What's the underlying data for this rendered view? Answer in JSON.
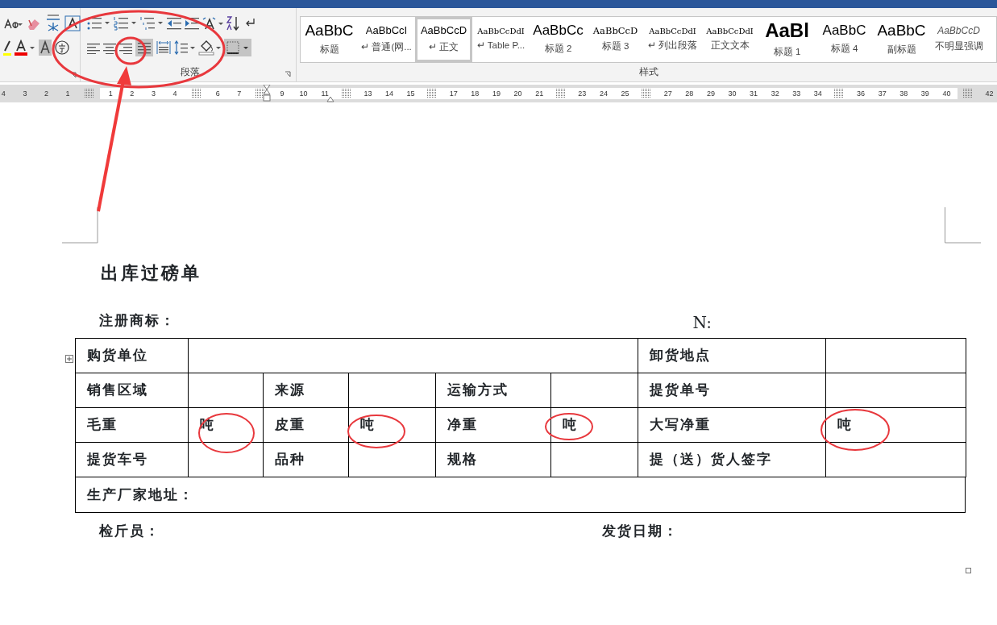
{
  "paragraph_group": {
    "label": "段落"
  },
  "styles_group": {
    "label": "样式",
    "items": [
      {
        "preview": "AaBbC",
        "label": "标题",
        "kind": "title",
        "selected": false
      },
      {
        "preview": "AaBbCcI",
        "label": "↵ 普通(网...",
        "kind": "normal",
        "selected": false
      },
      {
        "preview": "AaBbCcD",
        "label": "↵ 正文",
        "kind": "normal",
        "selected": true
      },
      {
        "preview": "AaBbCcDdI",
        "label": "↵ Table P...",
        "kind": "small",
        "selected": false
      },
      {
        "preview": "AaBbCc",
        "label": "标题 2",
        "kind": "large",
        "selected": false
      },
      {
        "preview": "AaBbCcD",
        "label": "标题 3",
        "kind": "serif",
        "selected": false
      },
      {
        "preview": "AaBbCcDdI",
        "label": "↵ 列出段落",
        "kind": "small",
        "selected": false
      },
      {
        "preview": "AaBbCcDdI",
        "label": "正文文本",
        "kind": "small",
        "selected": false
      },
      {
        "preview": "AaBl",
        "label": "标题 1",
        "kind": "huge",
        "selected": false
      },
      {
        "preview": "AaBbC",
        "label": "标题 4",
        "kind": "large",
        "selected": false
      },
      {
        "preview": "AaBbC",
        "label": "副标题",
        "kind": "title",
        "selected": false
      },
      {
        "preview": "AaBbCcD",
        "label": "不明显强调",
        "kind": "italic",
        "selected": false
      }
    ]
  },
  "ruler": {
    "left_margin": [
      {
        "kind": "num",
        "text": "4"
      },
      {
        "kind": "num",
        "text": "3"
      },
      {
        "kind": "num",
        "text": "2"
      },
      {
        "kind": "num",
        "text": "1"
      },
      {
        "kind": "cell"
      }
    ],
    "body": [
      {
        "kind": "num",
        "text": "1"
      },
      {
        "kind": "num",
        "text": "2"
      },
      {
        "kind": "num",
        "text": "3"
      },
      {
        "kind": "num",
        "text": "4"
      },
      {
        "kind": "cell"
      },
      {
        "kind": "num",
        "text": "6"
      },
      {
        "kind": "num",
        "text": "7"
      },
      {
        "kind": "cell"
      },
      {
        "kind": "num",
        "text": "9"
      },
      {
        "kind": "num",
        "text": "10"
      },
      {
        "kind": "num",
        "text": "11"
      },
      {
        "kind": "cell"
      },
      {
        "kind": "num",
        "text": "13"
      },
      {
        "kind": "num",
        "text": "14"
      },
      {
        "kind": "num",
        "text": "15"
      },
      {
        "kind": "cell"
      },
      {
        "kind": "num",
        "text": "17"
      },
      {
        "kind": "num",
        "text": "18"
      },
      {
        "kind": "num",
        "text": "19"
      },
      {
        "kind": "num",
        "text": "20"
      },
      {
        "kind": "num",
        "text": "21"
      },
      {
        "kind": "cell"
      },
      {
        "kind": "num",
        "text": "23"
      },
      {
        "kind": "num",
        "text": "24"
      },
      {
        "kind": "num",
        "text": "25"
      },
      {
        "kind": "cell"
      },
      {
        "kind": "num",
        "text": "27"
      },
      {
        "kind": "num",
        "text": "28"
      },
      {
        "kind": "num",
        "text": "29"
      },
      {
        "kind": "num",
        "text": "30"
      },
      {
        "kind": "num",
        "text": "31"
      },
      {
        "kind": "num",
        "text": "32"
      },
      {
        "kind": "num",
        "text": "33"
      },
      {
        "kind": "num",
        "text": "34"
      },
      {
        "kind": "cell"
      },
      {
        "kind": "num",
        "text": "36"
      },
      {
        "kind": "num",
        "text": "37"
      },
      {
        "kind": "num",
        "text": "38"
      },
      {
        "kind": "num",
        "text": "39"
      },
      {
        "kind": "num",
        "text": "40"
      }
    ],
    "right_margin": [
      {
        "kind": "cell"
      },
      {
        "kind": "num",
        "text": "42"
      }
    ]
  },
  "document": {
    "title": "出库过磅单",
    "trademark": "注册商标：",
    "number_label": "N:",
    "table": {
      "rows": [
        [
          "购货单位",
          "",
          "",
          "",
          "",
          "",
          "卸货地点",
          ""
        ],
        [
          "销售区域",
          "",
          "来源",
          "",
          "运输方式",
          "",
          "提货单号",
          ""
        ],
        [
          "毛重",
          "吨",
          "皮重",
          "吨",
          "净重",
          "吨",
          "大写净重",
          "吨"
        ],
        [
          "提货车号",
          "",
          "品种",
          "",
          "规格",
          "",
          "提（送）货人签字",
          ""
        ]
      ]
    },
    "address_row": "生产厂家地址：",
    "inspector": "检斤员：",
    "ship_date": "发货日期："
  }
}
